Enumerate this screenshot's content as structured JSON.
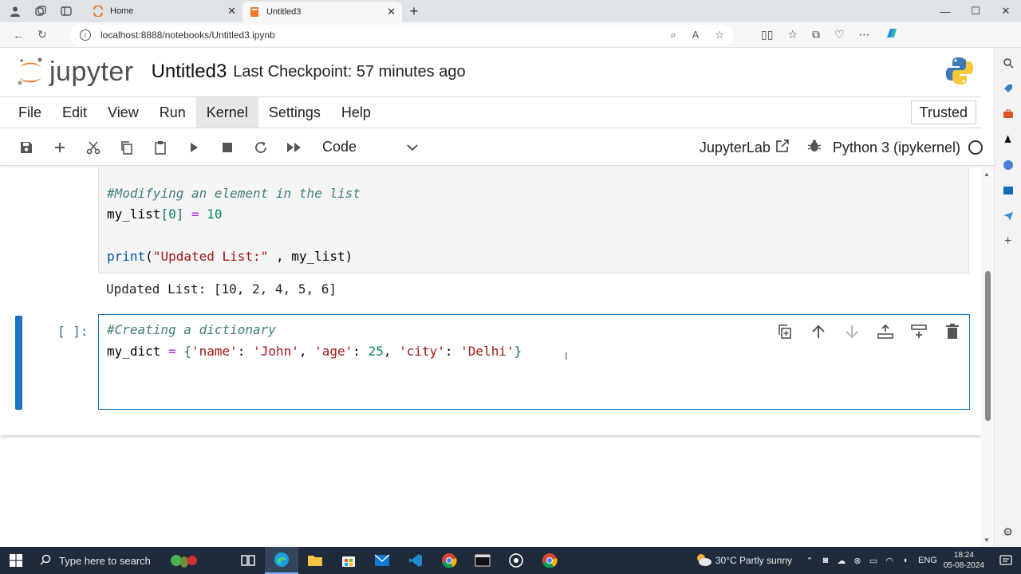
{
  "browser": {
    "tabs": [
      {
        "title": "Home",
        "active": false
      },
      {
        "title": "Untitled3",
        "active": true
      }
    ],
    "url": "localhost:8888/notebooks/Untitled3.ipynb"
  },
  "jupyter": {
    "logo_text": "jupyter",
    "notebook_title": "Untitled3",
    "checkpoint": "Last Checkpoint: 57 minutes ago",
    "menu": [
      "File",
      "Edit",
      "View",
      "Run",
      "Kernel",
      "Settings",
      "Help"
    ],
    "highlighted_menu": "Kernel",
    "trusted": "Trusted",
    "cell_type": "Code",
    "jupyterlab_link": "JupyterLab",
    "kernel_name": "Python 3 (ipykernel)"
  },
  "cells": {
    "cell1": {
      "line1": "#Modifying an element in the list",
      "line2_var": "my_list",
      "line2_idx": "0",
      "line2_val": "10",
      "line4_fn": "print",
      "line4_str": "\"Updated List:\"",
      "line4_arg": "my_list",
      "output": "Updated List: [10, 2, 4, 5, 6]"
    },
    "cell2": {
      "prompt": "[ ]:",
      "line1": "#Creating a dictionary",
      "line2_var": "my_dict",
      "k1": "'name'",
      "v1": "'John'",
      "k2": "'age'",
      "v2": "25",
      "k3": "'city'",
      "v3": "'Delhi'"
    }
  },
  "taskbar": {
    "search_placeholder": "Type here to search",
    "weather": "30°C  Partly sunny",
    "lang": "ENG",
    "time": "18:24",
    "date": "05-08-2024"
  },
  "colors": {
    "active_cell": "#1a73c4",
    "jupyter_orange": "#f37726",
    "taskbar": "#1f2a3a"
  }
}
